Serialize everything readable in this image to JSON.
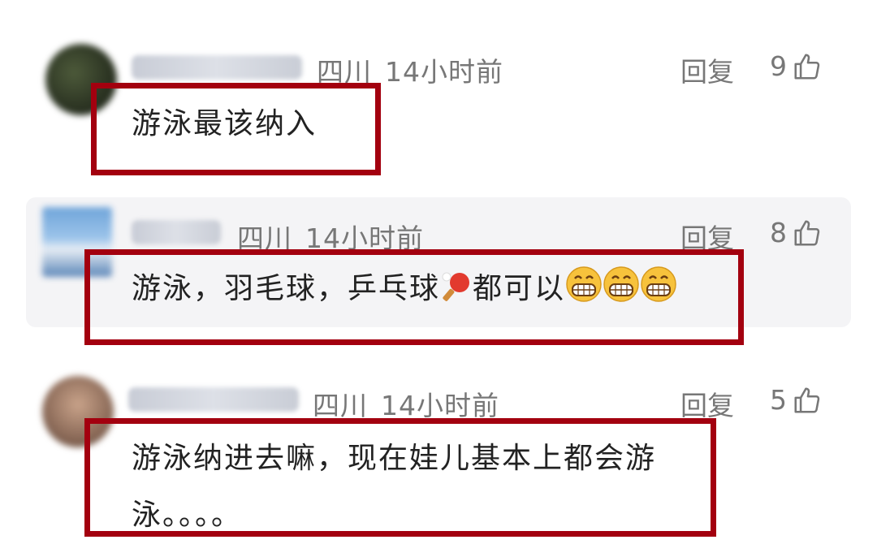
{
  "comments": [
    {
      "location": "四川",
      "time": "14小时前",
      "reply_label": "回复",
      "likes": "9",
      "text": "游泳最该纳入"
    },
    {
      "location": "四川",
      "time": "14小时前",
      "reply_label": "回复",
      "likes": "8",
      "text_before_emoji": "游泳，羽毛球，乒乓球",
      "text_after_emoji": "都可以",
      "emojis": [
        "ping-pong-icon",
        "grinning-face-icon",
        "grinning-face-icon",
        "grinning-face-icon"
      ]
    },
    {
      "location": "四川",
      "time": "14小时前",
      "reply_label": "回复",
      "likes": "5",
      "text_line1": "游泳纳进去嘛，现在娃儿基本上都会游",
      "text_line2": "泳。。。。"
    }
  ],
  "colors": {
    "highlight_frame": "#a3000f",
    "meta_text": "#777777",
    "body_text": "#222222",
    "quoted_bg": "#f4f4f6"
  }
}
